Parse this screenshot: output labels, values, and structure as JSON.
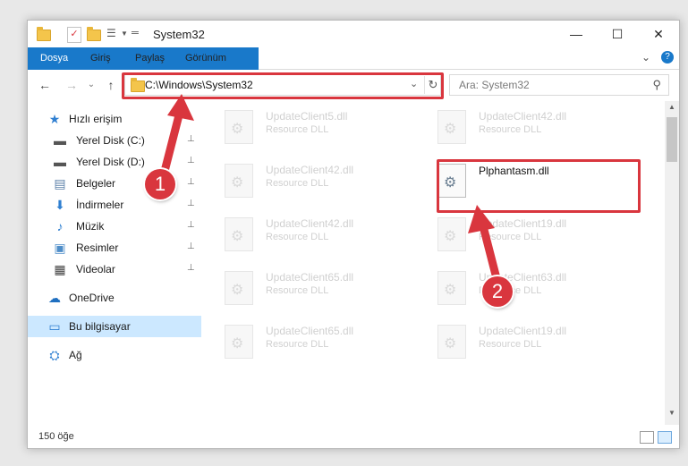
{
  "window": {
    "title": "System32",
    "controls": {
      "minimize": "—",
      "maximize": "☐",
      "close": "✕"
    }
  },
  "ribbon": {
    "tabs": [
      "Dosya",
      "Giriş",
      "Paylaş",
      "Görünüm"
    ],
    "collapse_icon": "⌄",
    "help_icon": "?"
  },
  "address": {
    "path": "C:\\Windows\\System32",
    "back": "←",
    "forward": "→",
    "recent": "⌄",
    "up": "↑",
    "dropdown": "⌄",
    "refresh": "↻"
  },
  "search": {
    "placeholder": "Ara: System32",
    "icon": "⚲"
  },
  "nav": {
    "items": [
      {
        "label": "Hızlı erişim",
        "icon": "★",
        "pinned": false,
        "top": true
      },
      {
        "label": "Yerel Disk (C:)",
        "icon": "▬",
        "pinned": true
      },
      {
        "label": "Yerel Disk (D:)",
        "icon": "▬",
        "pinned": true
      },
      {
        "label": "Belgeler",
        "icon": "▤",
        "pinned": true
      },
      {
        "label": "İndirmeler",
        "icon": "⬇",
        "pinned": true
      },
      {
        "label": "Müzik",
        "icon": "♪",
        "pinned": true
      },
      {
        "label": "Resimler",
        "icon": "▣",
        "pinned": true
      },
      {
        "label": "Videolar",
        "icon": "▦",
        "pinned": true
      },
      {
        "label": "OneDrive",
        "icon": "☁",
        "pinned": false,
        "top": true
      },
      {
        "label": "Bu bilgisayar",
        "icon": "▭",
        "pinned": false,
        "top": true,
        "selected": true
      },
      {
        "label": "Ağ",
        "icon": "⛭",
        "pinned": false,
        "top": true
      }
    ],
    "pin_icon": "📌"
  },
  "files": [
    {
      "name": "UpdateClient5.dll",
      "type": "Resource DLL",
      "faded": true
    },
    {
      "name": "UpdateClient42.dll",
      "type": "Resource DLL",
      "faded": true
    },
    {
      "name": "UpdateClient42.dll",
      "type": "Resource DLL",
      "faded": true
    },
    {
      "name": "Plphantasm.dll",
      "type": "",
      "faded": false
    },
    {
      "name": "UpdateClient42.dll",
      "type": "Resource DLL",
      "faded": true
    },
    {
      "name": "UpdateClient19.dll",
      "type": "Resource DLL",
      "faded": true
    },
    {
      "name": "UpdateClient65.dll",
      "type": "Resource DLL",
      "faded": true
    },
    {
      "name": "UpdateClient63.dll",
      "type": "Resource DLL",
      "faded": true
    },
    {
      "name": "UpdateClient65.dll",
      "type": "Resource DLL",
      "faded": true
    },
    {
      "name": "UpdateClient19.dll",
      "type": "Resource DLL",
      "faded": true
    }
  ],
  "status": {
    "count": "150 öğe"
  },
  "annotations": {
    "badge1": "1",
    "badge2": "2",
    "accent": "#d9363e"
  }
}
